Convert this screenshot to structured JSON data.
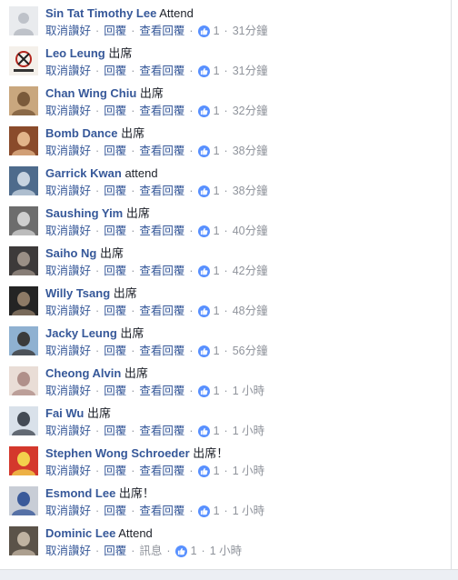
{
  "comments": [
    {
      "author": "Sin Tat Timothy Lee",
      "text": "Attend",
      "actions": [
        "取消讚好",
        "回覆",
        "查看回覆"
      ],
      "likes": "1",
      "time": "31分鐘",
      "avatar": {
        "bg": "#e9ebee",
        "fg": "#bec2c9",
        "kind": "default"
      }
    },
    {
      "author": "Leo Leung",
      "text": "出席",
      "actions": [
        "取消讚好",
        "回覆",
        "查看回覆"
      ],
      "likes": "1",
      "time": "31分鐘",
      "avatar": {
        "bg": "#f4f0ea",
        "fg": "#b3261e",
        "kind": "logo"
      }
    },
    {
      "author": "Chan Wing Chiu",
      "text": "出席",
      "actions": [
        "取消讚好",
        "回覆",
        "查看回覆"
      ],
      "likes": "1",
      "time": "32分鐘",
      "avatar": {
        "bg": "#c9a77e",
        "fg": "#7a5a3a",
        "kind": "photo"
      }
    },
    {
      "author": "Bomb Dance",
      "text": "出席",
      "actions": [
        "取消讚好",
        "回覆",
        "查看回覆"
      ],
      "likes": "1",
      "time": "38分鐘",
      "avatar": {
        "bg": "#8a4b2b",
        "fg": "#e2b48a",
        "kind": "photo"
      }
    },
    {
      "author": "Garrick Kwan",
      "text": "attend",
      "actions": [
        "取消讚好",
        "回覆",
        "查看回覆"
      ],
      "likes": "1",
      "time": "38分鐘",
      "avatar": {
        "bg": "#4e6b8c",
        "fg": "#c7d3e0",
        "kind": "photo"
      }
    },
    {
      "author": "Saushing Yim",
      "text": "出席",
      "actions": [
        "取消讚好",
        "回覆",
        "查看回覆"
      ],
      "likes": "1",
      "time": "40分鐘",
      "avatar": {
        "bg": "#6d6d6d",
        "fg": "#cfcfcf",
        "kind": "photo"
      }
    },
    {
      "author": "Saiho Ng",
      "text": "出席",
      "actions": [
        "取消讚好",
        "回覆",
        "查看回覆"
      ],
      "likes": "1",
      "time": "42分鐘",
      "avatar": {
        "bg": "#3d3a3a",
        "fg": "#9a8f86",
        "kind": "photo"
      }
    },
    {
      "author": "Willy Tsang",
      "text": "出席",
      "actions": [
        "取消讚好",
        "回覆",
        "查看回覆"
      ],
      "likes": "1",
      "time": "48分鐘",
      "avatar": {
        "bg": "#242424",
        "fg": "#8d7a66",
        "kind": "photo"
      }
    },
    {
      "author": "Jacky Leung",
      "text": "出席",
      "actions": [
        "取消讚好",
        "回覆",
        "查看回覆"
      ],
      "likes": "1",
      "time": "56分鐘",
      "avatar": {
        "bg": "#8fb1d1",
        "fg": "#3b3b3b",
        "kind": "photo"
      }
    },
    {
      "author": "Cheong Alvin",
      "text": "出席",
      "actions": [
        "取消讚好",
        "回覆",
        "查看回覆"
      ],
      "likes": "1",
      "time": "1 小時",
      "avatar": {
        "bg": "#e9ddd6",
        "fg": "#b0908a",
        "kind": "photo"
      }
    },
    {
      "author": "Fai Wu",
      "text": "出席",
      "actions": [
        "取消讚好",
        "回覆",
        "查看回覆"
      ],
      "likes": "1",
      "time": "1 小時",
      "avatar": {
        "bg": "#d9e1ea",
        "fg": "#444b55",
        "kind": "photo"
      }
    },
    {
      "author": "Stephen Wong Schroeder",
      "text": "出席！",
      "actions": [
        "取消讚好",
        "回覆",
        "查看回覆"
      ],
      "likes": "1",
      "time": "1 小時",
      "avatar": {
        "bg": "#d4382c",
        "fg": "#f3d04c",
        "kind": "photo"
      }
    },
    {
      "author": "Esmond Lee",
      "text": "出席！",
      "actions": [
        "取消讚好",
        "回覆",
        "查看回覆"
      ],
      "likes": "1",
      "time": "1 小時",
      "avatar": {
        "bg": "#c8cdd6",
        "fg": "#3a5a9a",
        "kind": "photo"
      }
    },
    {
      "author": "Dominic Lee",
      "text": "Attend",
      "actions": [
        "取消讚好",
        "回覆",
        "訊息"
      ],
      "likes": "1",
      "time": "1 小時",
      "avatar": {
        "bg": "#5b5349",
        "fg": "#c0b3a1",
        "kind": "photo"
      }
    }
  ]
}
